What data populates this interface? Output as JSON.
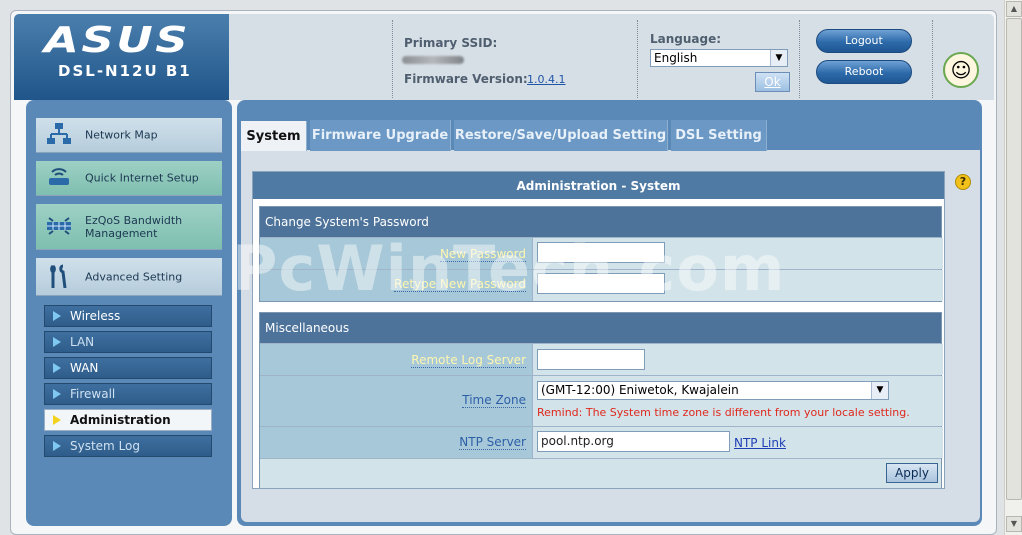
{
  "header": {
    "brand": "ASUS",
    "model": "DSL-N12U B1",
    "ssid_label": "Primary SSID:",
    "firmware_label": "Firmware Version:",
    "firmware_version": "1.0.4.1",
    "language_label": "Language:",
    "language_value": "English",
    "ok_label": "Ok",
    "logout_label": "Logout",
    "reboot_label": "Reboot"
  },
  "sidebar": {
    "main_items": [
      {
        "label": "Network Map",
        "icon": "network-map-icon"
      },
      {
        "label": "Quick Internet Setup",
        "icon": "router-icon"
      },
      {
        "label": "EzQoS Bandwidth Management",
        "icon": "qos-icon"
      },
      {
        "label": "Advanced Setting",
        "icon": "tools-icon"
      }
    ],
    "sub_items": [
      {
        "label": "Wireless"
      },
      {
        "label": "LAN"
      },
      {
        "label": "WAN"
      },
      {
        "label": "Firewall"
      },
      {
        "label": "Administration"
      },
      {
        "label": "System Log"
      }
    ]
  },
  "tabs": [
    "System",
    "Firmware Upgrade",
    "Restore/Save/Upload Setting",
    "DSL Setting"
  ],
  "panel": {
    "title": "Administration - System",
    "password_section": "Change System's Password",
    "new_password_label": "New Password",
    "retype_password_label": "Retype New Password",
    "misc_section": "Miscellaneous",
    "remote_log_label": "Remote Log Server",
    "remote_log_value": "",
    "time_zone_label": "Time Zone",
    "time_zone_value": "(GMT-12:00) Eniwetok, Kwajalein",
    "time_zone_remind": "Remind: The System time zone is different from your locale setting.",
    "ntp_label": "NTP Server",
    "ntp_value": "pool.ntp.org",
    "ntp_link": "NTP Link",
    "apply_label": "Apply",
    "help_icon": "?"
  },
  "watermark": "PcWinTech.com"
}
